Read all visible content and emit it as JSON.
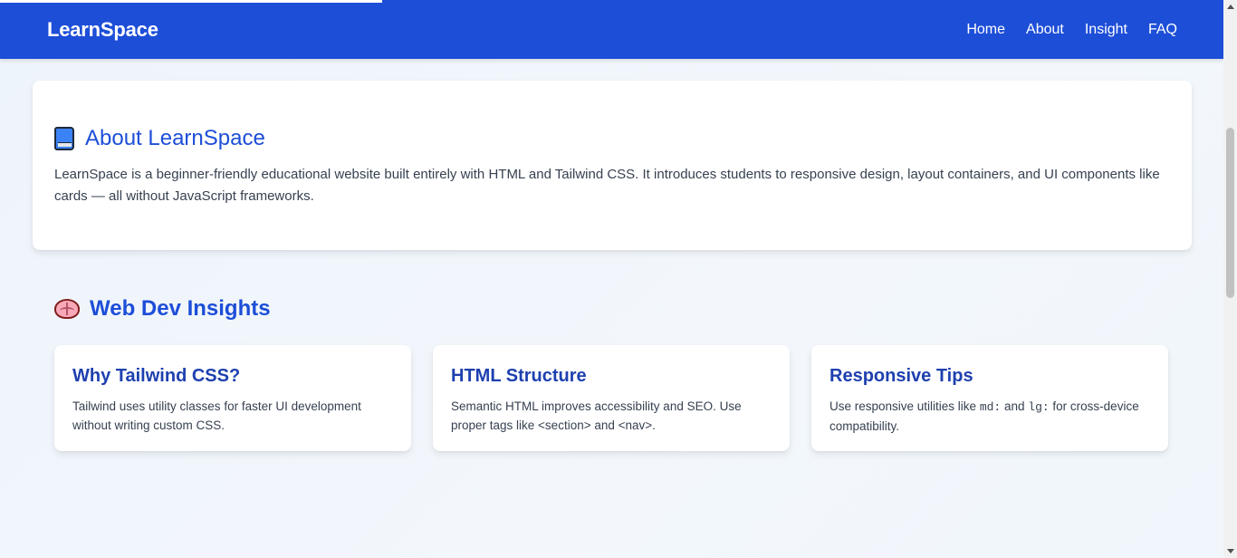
{
  "nav": {
    "brand": "LearnSpace",
    "links": [
      "Home",
      "About",
      "Insight",
      "FAQ"
    ]
  },
  "about": {
    "icon": "book-icon",
    "title": "About LearnSpace",
    "text": "LearnSpace is a beginner-friendly educational website built entirely with HTML and Tailwind CSS. It introduces students to responsive design, layout containers, and UI components like cards — all without JavaScript frameworks."
  },
  "insights": {
    "icon": "brain-icon",
    "title": "Web Dev Insights",
    "cards": [
      {
        "title": "Why Tailwind CSS?",
        "text": "Tailwind uses utility classes for faster UI development without writing custom CSS."
      },
      {
        "title": "HTML Structure",
        "text": "Semantic HTML improves accessibility and SEO. Use proper tags like <section> and <nav>."
      },
      {
        "title": "Responsive Tips",
        "text_before": "Use responsive utilities like ",
        "code1": "md:",
        "text_mid": " and ",
        "code2": "lg:",
        "text_after": " for cross-device compatibility."
      }
    ]
  },
  "colors": {
    "nav_bg": "#1d4ed8",
    "heading": "#1d4ed8",
    "card_title": "#1e40af"
  }
}
